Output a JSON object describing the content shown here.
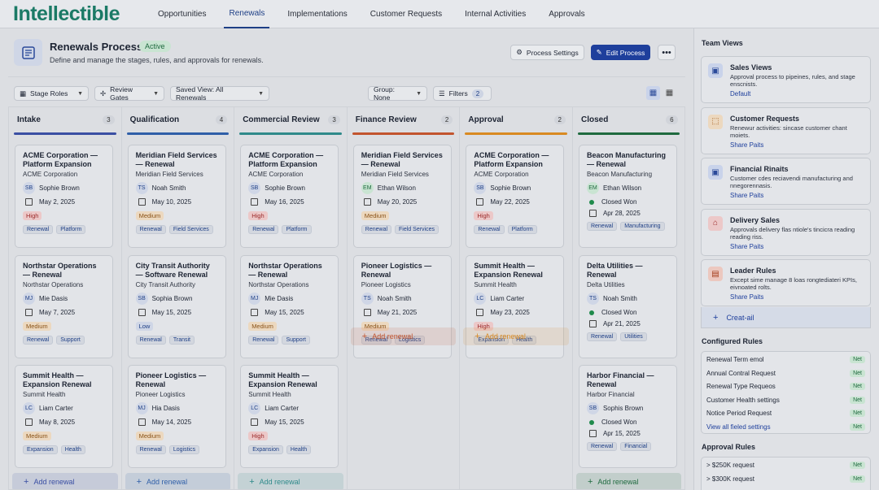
{
  "app": {
    "logo": "Intellectible",
    "nav": [
      "Opportunities",
      "Renewals",
      "Implementations",
      "Customer Requests",
      "Internal Activities",
      "Approvals"
    ],
    "active_nav": "Renewals"
  },
  "header": {
    "title": "Renewals Process",
    "status": "Active",
    "subtitle": "Define and manage the stages, rules, and approvals for renewals.",
    "process_settings": "Process Settings",
    "edit_process": "Edit Process",
    "more": "•••"
  },
  "filters": {
    "stage_roles": "Stage Roles",
    "review_gates": "Review Gates",
    "saved_view": "Saved View: All Renewals",
    "group": "Group: None",
    "filters_label": "Filters",
    "filters_count": "2"
  },
  "add_renewal": "Add renewal",
  "columns": [
    {
      "title": "Intake",
      "count": "3",
      "color": "#3a4fa3",
      "cards": [
        {
          "title": "ACME Corporation — Platform Expansion",
          "company": "ACME Corporation",
          "initials": "SB",
          "owner": "Sophie Brown",
          "date": "May 2, 2025",
          "priority": "High",
          "tags": [
            "Renewal",
            "Platform"
          ]
        },
        {
          "title": "Northstar Operations — Renewal",
          "company": "Northstar Operations",
          "initials": "MJ",
          "owner": "Mie Dasis",
          "date": "May 7, 2025",
          "priority": "Medium",
          "tags": [
            "Renewal",
            "Support"
          ]
        },
        {
          "title": "Summit Health — Expansion Renewal",
          "company": "Summit Health",
          "initials": "LC",
          "owner": "Liam Carter",
          "date": "May 8, 2025",
          "priority": "Medium",
          "tags": [
            "Expansion",
            "Health"
          ]
        }
      ]
    },
    {
      "title": "Qualification",
      "count": "4",
      "color": "#2f5fa8",
      "cards": [
        {
          "title": "Meridian Field Services — Renewal",
          "company": "Meridian Field Services",
          "initials": "TS",
          "owner": "Noah Smith",
          "date": "May 10, 2025",
          "priority": "Medium",
          "tags": [
            "Renewal",
            "Field Services"
          ]
        },
        {
          "title": "City Transit Authority — Software Renewal",
          "company": "City Transit Authority",
          "initials": "SB",
          "owner": "Sophia Brown",
          "date": "May 15, 2025",
          "priority": "Low",
          "tags": [
            "Renewal",
            "Transit"
          ]
        },
        {
          "title": "Pioneer Logistics — Renewal",
          "company": "Pioneer Logistics",
          "initials": "MJ",
          "owner": "Hia Dasis",
          "date": "May 14, 2025",
          "priority": "Medium",
          "tags": [
            "Renewal",
            "Logistics"
          ]
        }
      ]
    },
    {
      "title": "Commercial Review",
      "count": "3",
      "color": "#2f8a8a",
      "cards": [
        {
          "title": "ACME Corporation — Platform Expansion",
          "company": "ACME Corporation",
          "initials": "SB",
          "owner": "Sophie Brown",
          "date": "May 16, 2025",
          "priority": "High",
          "tags": [
            "Renewal",
            "Platform"
          ]
        },
        {
          "title": "Northstar Operations — Renewal",
          "company": "Northstar Operations",
          "initials": "MJ",
          "owner": "Mie Dasis",
          "date": "May 15, 2025",
          "priority": "Medium",
          "tags": [
            "Renewal",
            "Support"
          ]
        },
        {
          "title": "Summit Health — Expansion Renewal",
          "company": "Summit Health",
          "initials": "LC",
          "owner": "Liam Carter",
          "date": "May 15, 2025",
          "priority": "High",
          "tags": [
            "Expansion",
            "Health"
          ]
        }
      ]
    },
    {
      "title": "Finance Review",
      "count": "2",
      "color": "#c2542e",
      "cards": [
        {
          "title": "Meridian Field Services — Renewal",
          "company": "Meridian Field Services",
          "initials": "EM",
          "owner": "Ethan Wilson",
          "date": "May 20, 2025",
          "priority": "Medium",
          "tags": [
            "Renewal",
            "Field Services"
          ],
          "green": true
        },
        {
          "title": "Pioneer Logistics — Renewal",
          "company": "Pioneer Logistics",
          "initials": "TS",
          "owner": "Noah Smith",
          "date": "May 21, 2025",
          "priority": "Medium",
          "tags": [
            "Renewal",
            "Logistics"
          ]
        }
      ]
    },
    {
      "title": "Approval",
      "count": "2",
      "color": "#d98a22",
      "cards": [
        {
          "title": "ACME Corporation — Platform Expansion",
          "company": "ACME Corporation",
          "initials": "SB",
          "owner": "Sophie Brown",
          "date": "May 22, 2025",
          "priority": "High",
          "tags": [
            "Renewal",
            "Platform"
          ]
        },
        {
          "title": "Summit Health — Expansion Renewal",
          "company": "Summit Health",
          "initials": "LC",
          "owner": "Liam Carter",
          "date": "May 23, 2025",
          "priority": "High",
          "tags": [
            "Expansion",
            "Health"
          ]
        }
      ]
    },
    {
      "title": "Closed",
      "count": "6",
      "color": "#1f6a3f",
      "cards": [
        {
          "title": "Beacon Manufacturing — Renewal",
          "company": "Beacon Manufacturing",
          "initials": "EM",
          "owner": "Ethan Wilson",
          "status": "Closed Won",
          "date": "Apr 28, 2025",
          "tags": [
            "Renewal",
            "Manufacturing"
          ],
          "green": true
        },
        {
          "title": "Delta Utilities — Renewal",
          "company": "Delta Utilities",
          "initials": "TS",
          "owner": "Noah Smith",
          "status": "Closed Won",
          "date": "Apr 21, 2025",
          "tags": [
            "Renewal",
            "Utilities"
          ]
        },
        {
          "title": "Harbor Financial — Renewal",
          "company": "Harbor Financial",
          "initials": "SB",
          "owner": "Sophis Brown",
          "status": "Closed Won",
          "date": "Apr 15, 2025",
          "tags": [
            "Renewal",
            "Financial"
          ]
        }
      ]
    }
  ],
  "sidebar": {
    "team_views_title": "Team Views",
    "team_views": [
      {
        "title": "Sales Views",
        "desc": "Approval process to pipeines, rules, and stage enscnists.",
        "link": "Default",
        "icon_bg": "#c9d3ea",
        "icon_color": "#2b4a9a"
      },
      {
        "title": "Customer Requests",
        "desc": "Renewur activities: sincase customer chant moiets.",
        "link": "Share Paits",
        "icon_bg": "#ecd8bf",
        "icon_color": "#a35b18"
      },
      {
        "title": "Financial Rinaits",
        "desc": "Customer cdes reciavendi manufacturing and nnegorennasis.",
        "link": "Share Paits",
        "icon_bg": "#c9d3ea",
        "icon_color": "#2b4a9a"
      },
      {
        "title": "Delivery Sales",
        "desc": "Approvals delivery flas ntiole's tincicra reading reading riss.",
        "link": "Share Paits",
        "icon_bg": "#ecc8c8",
        "icon_color": "#9b2a2a"
      },
      {
        "title": "Leader Rules",
        "desc": "Except sime manage 8 loas rongtediateri KPIs, eivnoated rolts.",
        "link": "Share Paits",
        "icon_bg": "#ecc8bf",
        "icon_color": "#a33b18"
      }
    ],
    "create": "Creat-ail",
    "configured_title": "Configured Rules",
    "configured": [
      {
        "label": "Renewal Term emol",
        "badge": "Net"
      },
      {
        "label": "Annual Contral Request",
        "badge": "Net"
      },
      {
        "label": "Renewal Type Requeos",
        "badge": "Net"
      },
      {
        "label": "Customer Health settings",
        "badge": "Net"
      },
      {
        "label": "Notice Period Request",
        "badge": "Net"
      },
      {
        "label": "View all fieled settings",
        "badge": "Net",
        "link": true
      }
    ],
    "approval_title": "Approval Rules",
    "approval": [
      {
        "label": "> $250K request",
        "badge": "Net"
      },
      {
        "label": "> $300K request",
        "badge": "Net"
      }
    ]
  }
}
